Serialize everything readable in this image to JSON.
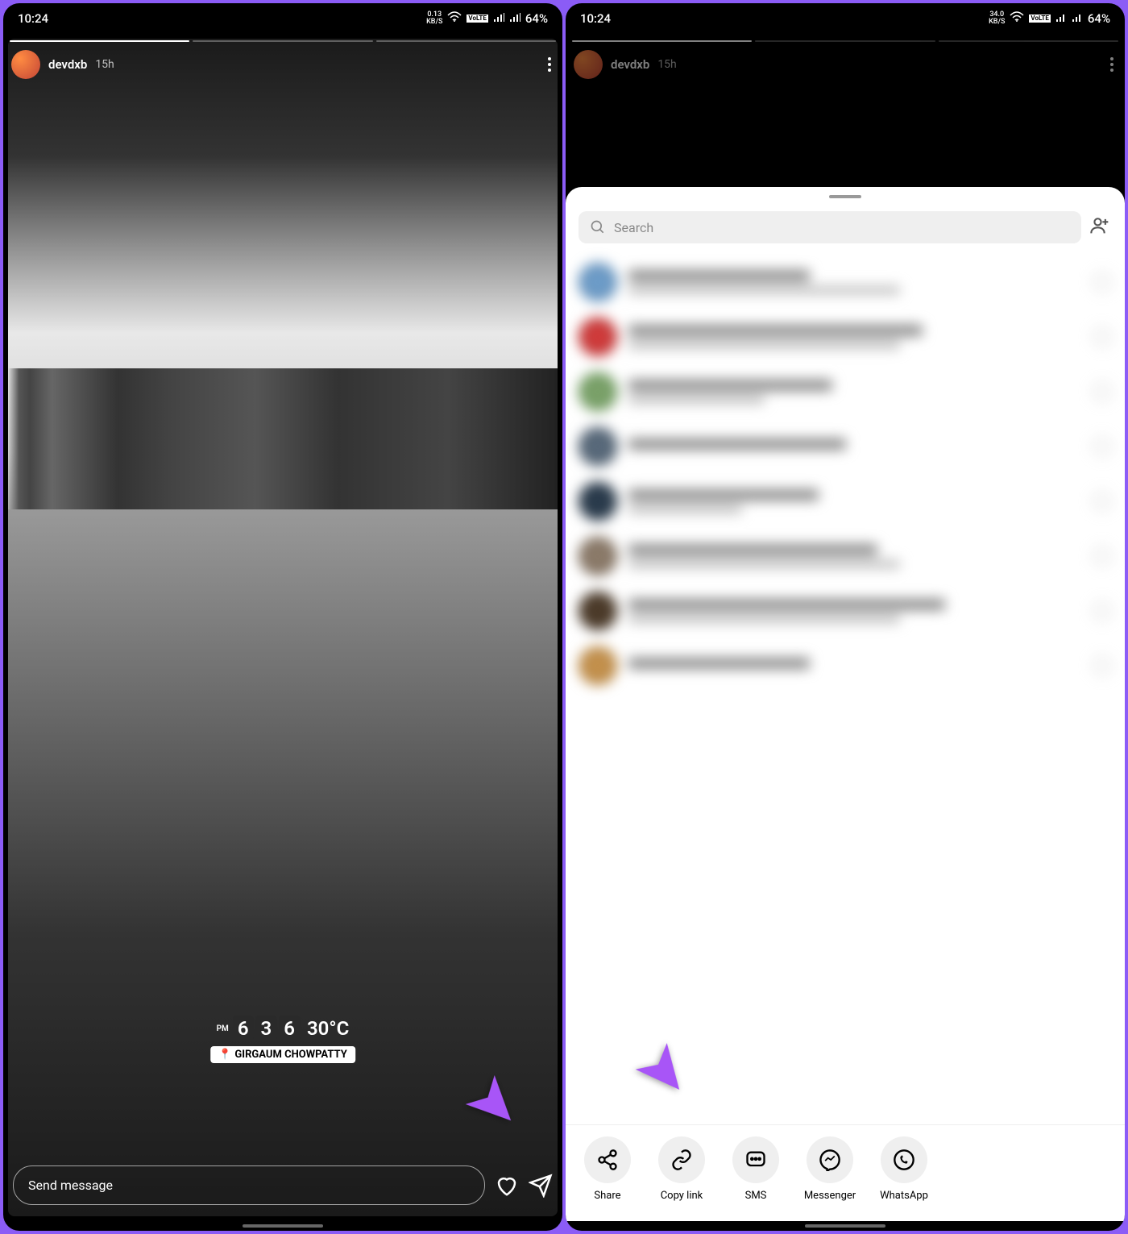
{
  "screen1": {
    "status": {
      "time": "10:24",
      "kbs": "0.13",
      "kbs_unit": "KB/S",
      "lte": "LTE",
      "battery": "64%"
    },
    "story": {
      "username": "devdxb",
      "time": "15h",
      "location": "GIRGAUM CHOWPATTY",
      "sticker_pm": "PM",
      "sticker_time_d1": "6",
      "sticker_time_d2": "3",
      "sticker_time_d3": "6",
      "sticker_temp": "30°C"
    },
    "footer": {
      "placeholder": "Send message"
    }
  },
  "screen2": {
    "status": {
      "time": "10:24",
      "kbs": "34.0",
      "kbs_unit": "KB/S",
      "lte": "LTE",
      "battery": "64%"
    },
    "story": {
      "username": "devdxb",
      "time": "15h"
    },
    "sheet": {
      "search_placeholder": "Search",
      "options": [
        {
          "label": "Share",
          "icon": "share"
        },
        {
          "label": "Copy link",
          "icon": "link"
        },
        {
          "label": "SMS",
          "icon": "sms"
        },
        {
          "label": "Messenger",
          "icon": "messenger"
        },
        {
          "label": "WhatsApp",
          "icon": "whatsapp"
        }
      ]
    }
  }
}
